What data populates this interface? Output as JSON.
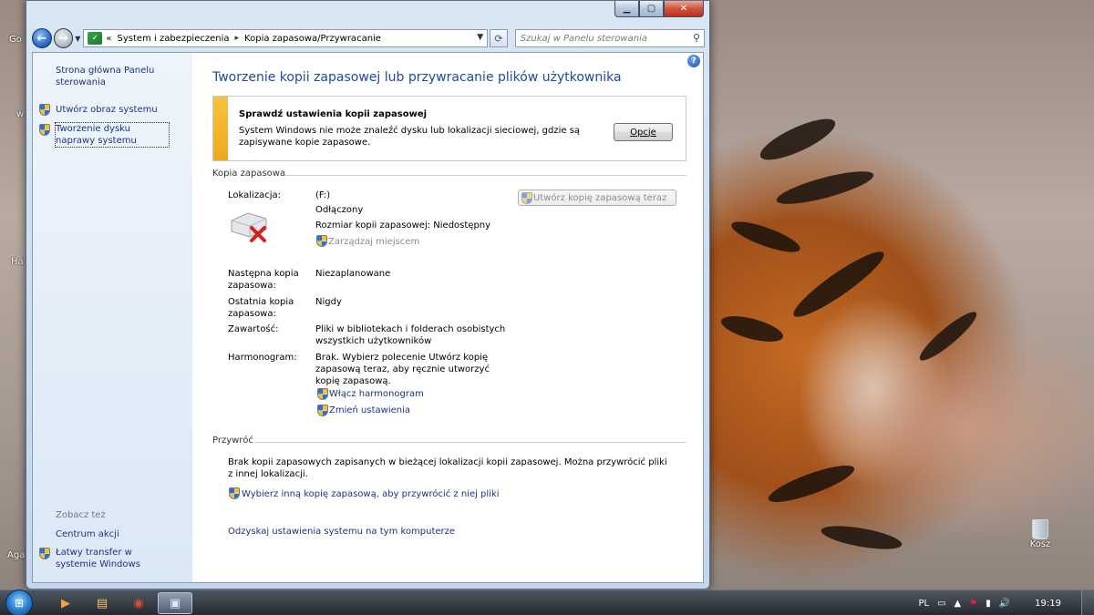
{
  "desktop": {
    "edge_labels": [
      "Go",
      "w",
      "Ha",
      "Aga"
    ],
    "recycle_bin_label": "Kosz"
  },
  "window": {
    "caption_buttons": {
      "minimize": "▁",
      "maximize": "▢",
      "close": "✕"
    },
    "breadcrumb": {
      "overflow": "«",
      "items": [
        "System i zabezpieczenia",
        "Kopia zapasowa/Przywracanie"
      ],
      "separator": "▸"
    },
    "search": {
      "placeholder": "Szukaj w Panelu sterowania"
    },
    "sidebar": {
      "home_link": "Strona główna Panelu sterowania",
      "tasks": [
        "Utwórz obraz systemu",
        "Tworzenie dysku naprawy systemu"
      ],
      "see_also_heading": "Zobacz też",
      "see_also": [
        "Centrum akcji",
        "Łatwy transfer w systemie Windows"
      ]
    },
    "main": {
      "title": "Tworzenie kopii zapasowej lub przywracanie plików użytkownika",
      "warning": {
        "title": "Sprawdź ustawienia kopii zapasowej",
        "text": "System Windows nie może znaleźć dysku lub lokalizacji sieciowej, gdzie są zapisywane kopie zapasowe.",
        "button": "Opcje"
      },
      "backup": {
        "heading": "Kopia zapasowa",
        "location_label": "Lokalizacja:",
        "location_drive": "(F:)",
        "location_status": "Odłączony",
        "size_text": "Rozmiar kopii zapasowej: Niedostępny",
        "manage_space": "Zarządzaj miejscem",
        "backup_now_button": "Utwórz kopię zapasową teraz",
        "next_label": "Następna kopia zapasowa:",
        "next_value": "Niezaplanowane",
        "last_label": "Ostatnia kopia zapasowa:",
        "last_value": "Nigdy",
        "contents_label": "Zawartość:",
        "contents_value": "Pliki w bibliotekach i folderach osobistych wszystkich użytkowników",
        "schedule_label": "Harmonogram:",
        "schedule_value": "Brak. Wybierz polecenie Utwórz kopię zapasową teraz, aby ręcznie utworzyć kopię zapasową.",
        "enable_schedule": "Włącz harmonogram",
        "change_settings": "Zmień ustawienia"
      },
      "restore": {
        "heading": "Przywróć",
        "text": "Brak kopii zapasowych zapisanych w bieżącej lokalizacji kopii zapasowej. Można przywrócić pliki z innej lokalizacji.",
        "select_other": "Wybierz inną kopię zapasową, aby przywrócić z niej pliki",
        "recover_system": "Odzyskaj ustawienia systemu na tym komputerze"
      }
    }
  },
  "taskbar": {
    "language": "PL",
    "clock": "19:19"
  },
  "colors": {
    "link": "#1e3287",
    "title": "#1e4aa8",
    "warning_bar": "#f0b22a"
  }
}
